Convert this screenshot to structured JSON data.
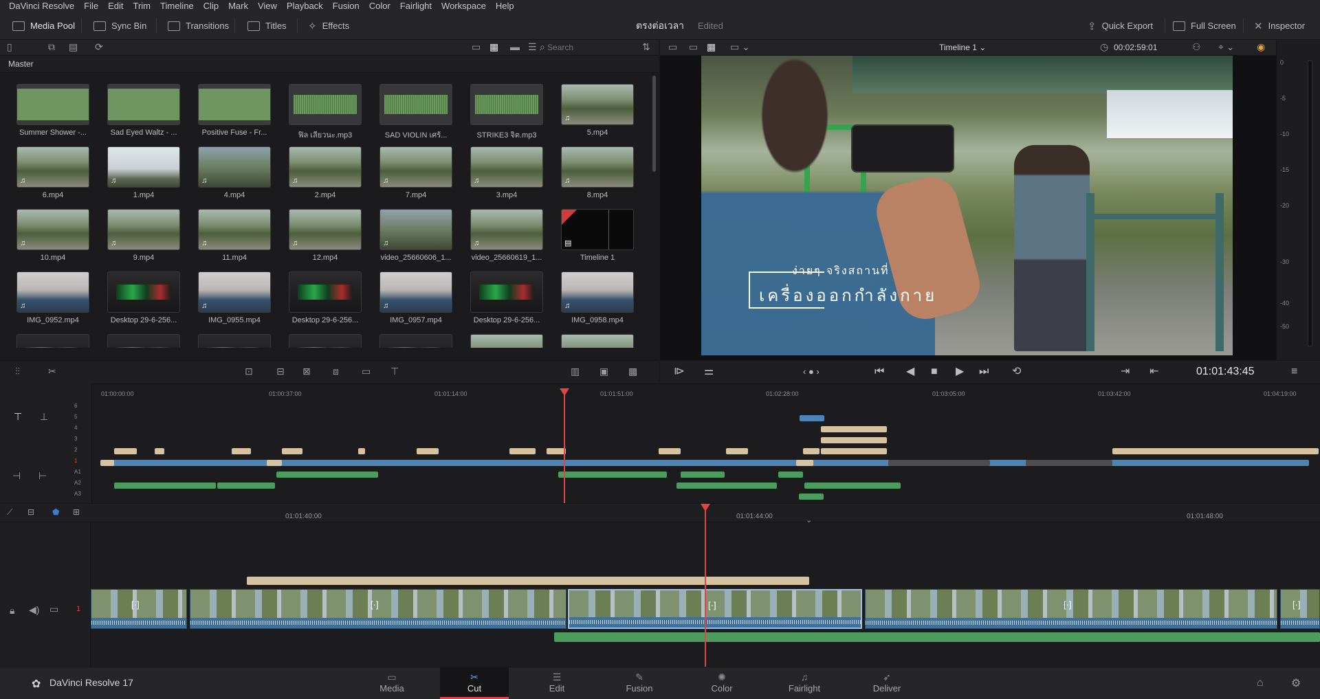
{
  "menu": [
    "DaVinci Resolve",
    "File",
    "Edit",
    "Trim",
    "Timeline",
    "Clip",
    "Mark",
    "View",
    "Playback",
    "Fusion",
    "Color",
    "Fairlight",
    "Workspace",
    "Help"
  ],
  "toolbar": {
    "media_pool": "Media Pool",
    "sync_bin": "Sync Bin",
    "transitions": "Transitions",
    "titles": "Titles",
    "effects": "Effects",
    "project_title": "ตรงต่อเวลา",
    "project_status": "Edited",
    "quick_export": "Quick Export",
    "full_screen": "Full Screen",
    "inspector": "Inspector"
  },
  "media_pool": {
    "search_placeholder": "Search",
    "bin": "Master",
    "clips": [
      {
        "name": "Summer Shower -...",
        "kind": "aud g1"
      },
      {
        "name": "Sad Eyed Waltz - ...",
        "kind": "aud g1"
      },
      {
        "name": "Positive Fuse - Fr...",
        "kind": "aud g1"
      },
      {
        "name": "ฟิล เลียวนะ.mp3",
        "kind": "aud"
      },
      {
        "name": "SAD VIOLIN เศร้...",
        "kind": "aud"
      },
      {
        "name": "STRIKE3 จิต.mp3",
        "kind": "aud"
      },
      {
        "name": "5.mp4",
        "kind": "vid"
      },
      {
        "name": "6.mp4",
        "kind": "vid"
      },
      {
        "name": "1.mp4",
        "kind": "vid2"
      },
      {
        "name": "4.mp4",
        "kind": "vid3"
      },
      {
        "name": "2.mp4",
        "kind": "vid"
      },
      {
        "name": "7.mp4",
        "kind": "vid"
      },
      {
        "name": "3.mp4",
        "kind": "vid"
      },
      {
        "name": "8.mp4",
        "kind": "vid"
      },
      {
        "name": "10.mp4",
        "kind": "vid"
      },
      {
        "name": "9.mp4",
        "kind": "vid"
      },
      {
        "name": "11.mp4",
        "kind": "vid"
      },
      {
        "name": "12.mp4",
        "kind": "vid"
      },
      {
        "name": "video_25660606_1...",
        "kind": "vid3"
      },
      {
        "name": "video_25660619_1...",
        "kind": "vid"
      },
      {
        "name": "Timeline 1",
        "kind": "tl"
      },
      {
        "name": "IMG_0952.mp4",
        "kind": "in"
      },
      {
        "name": "Desktop 29-6-256...",
        "kind": "desk"
      },
      {
        "name": "IMG_0955.mp4",
        "kind": "in"
      },
      {
        "name": "Desktop 29-6-256...",
        "kind": "desk"
      },
      {
        "name": "IMG_0957.mp4",
        "kind": "in"
      },
      {
        "name": "Desktop 29-6-256...",
        "kind": "desk"
      },
      {
        "name": "IMG_0958.mp4",
        "kind": "in"
      }
    ]
  },
  "viewer": {
    "timeline_name": "Timeline 1",
    "duration": "00:02:59:01",
    "timecode": "01:01:43:45",
    "subtitle_small": "ง่ายๆ จริงสถานที่",
    "subtitle_big": "เครื่องออกกำลังกาย",
    "meter_ticks": [
      "0",
      "-5",
      "-10",
      "-15",
      "-20",
      "-30",
      "-40",
      "-50"
    ]
  },
  "timeline_upper": {
    "ruler": [
      "01:00:00:00",
      "01:00:37:00",
      "01:01:14:00",
      "01:01:51:00",
      "01:02:28:00",
      "01:03:05:00",
      "01:03:42:00",
      "01:04:19:00"
    ],
    "tracks": [
      "6",
      "5",
      "4",
      "3",
      "2",
      "1",
      "A1",
      "A2",
      "A3"
    ]
  },
  "timeline_lower": {
    "ruler": [
      "01:01:40:00",
      "01:01:44:00",
      "01:01:48:00"
    ],
    "track_number": "1"
  },
  "pages": [
    {
      "label": "Media",
      "icon": "▭"
    },
    {
      "label": "Cut",
      "icon": "✂"
    },
    {
      "label": "Edit",
      "icon": "☰"
    },
    {
      "label": "Fusion",
      "icon": "✎"
    },
    {
      "label": "Color",
      "icon": "✺"
    },
    {
      "label": "Fairlight",
      "icon": "♫"
    },
    {
      "label": "Deliver",
      "icon": "➶"
    }
  ],
  "brand": "DaVinci Resolve 17",
  "colors": {
    "playhead": "#e04444",
    "video_track": "#4d85b8",
    "audio_track": "#4e9b60",
    "title_track": "#d5c3a2"
  }
}
